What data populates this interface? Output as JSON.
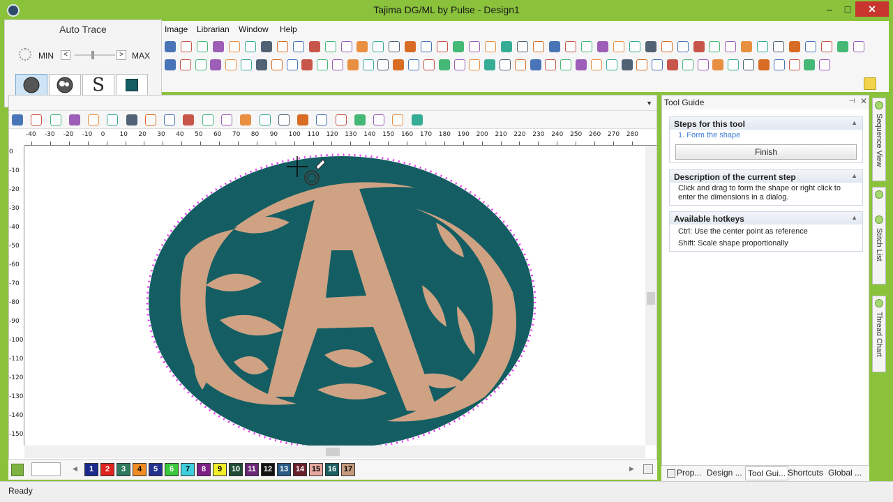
{
  "window": {
    "title": "Tajima DG/ML by Pulse - Design1"
  },
  "window_controls": {
    "minimize": "–",
    "maximize": "□",
    "close": "✕"
  },
  "menu": {
    "items": [
      "Image",
      "Librarian",
      "Window",
      "Help"
    ]
  },
  "auto_trace": {
    "title": "Auto Trace",
    "min_label": "MIN",
    "max_label": "MAX",
    "slider_value": 0.45,
    "left_arrow": "<",
    "right_arrow": ">",
    "modes": [
      "solid-circle-icon",
      "outline-circle-icon",
      "s-stitch-icon",
      "fill-square-icon"
    ],
    "s_glyph": "S"
  },
  "ruler": {
    "h_labels": [
      "-40",
      "-30",
      "-20",
      "-10",
      "0",
      "10",
      "20",
      "30",
      "40",
      "50",
      "60",
      "70",
      "80",
      "90",
      "100",
      "110",
      "120",
      "130",
      "140",
      "150",
      "160",
      "170",
      "180",
      "190",
      "200",
      "210",
      "220",
      "230",
      "240",
      "250",
      "260",
      "270",
      "280"
    ],
    "v_labels": [
      "0",
      "-10",
      "-20",
      "-30",
      "-40",
      "-50",
      "-60",
      "-70",
      "-80",
      "-90",
      "-100",
      "-110",
      "-120",
      "-130",
      "-140",
      "-150"
    ]
  },
  "palette": {
    "left_arrow": "◀",
    "right_arrow": "▶",
    "swatches": [
      {
        "n": "1",
        "color": "#1c2a8e",
        "text": "#ffffff"
      },
      {
        "n": "2",
        "color": "#e0231f",
        "text": "#ffffff"
      },
      {
        "n": "3",
        "color": "#2f7a5f",
        "text": "#ffffff"
      },
      {
        "n": "4",
        "color": "#f08a22",
        "text": "#000000"
      },
      {
        "n": "5",
        "color": "#25318f",
        "text": "#ffffff"
      },
      {
        "n": "6",
        "color": "#3cc83c",
        "text": "#ffffff"
      },
      {
        "n": "7",
        "color": "#3fd0e0",
        "text": "#000000"
      },
      {
        "n": "8",
        "color": "#7e1f86",
        "text": "#ffffff"
      },
      {
        "n": "9",
        "color": "#f3ee2a",
        "text": "#000000"
      },
      {
        "n": "10",
        "color": "#1f4b33",
        "text": "#ffffff"
      },
      {
        "n": "11",
        "color": "#6a2677",
        "text": "#ffffff"
      },
      {
        "n": "12",
        "color": "#111111",
        "text": "#ffffff"
      },
      {
        "n": "13",
        "color": "#2a5b86",
        "text": "#ffffff"
      },
      {
        "n": "14",
        "color": "#6a1f2b",
        "text": "#ffffff"
      },
      {
        "n": "15",
        "color": "#e8a9a0",
        "text": "#000000"
      },
      {
        "n": "16",
        "color": "#1b5e60",
        "text": "#ffffff"
      },
      {
        "n": "17",
        "color": "#c79b7e",
        "text": "#000000"
      }
    ]
  },
  "tool_guide": {
    "title": "Tool Guide",
    "pin": "⊣",
    "close": "✕",
    "steps_header": "Steps for this tool",
    "step_1": "1. Form the shape",
    "finish_label": "Finish",
    "description_header": "Description of the current step",
    "description_text": "Click and drag to form the shape or right click to enter the dimensions in a dialog.",
    "hotkeys_header": "Available hotkeys",
    "hotkey_1": "Ctrl: Use the center point as reference",
    "hotkey_2": "Shift: Scale shape proportionally",
    "collapse_arrow": "▲"
  },
  "side_tabs": [
    "Sequence View",
    "Stitch List",
    "Thread Chart"
  ],
  "bottom_tabs": [
    "Prop...",
    "Design ...",
    "Tool Gui...",
    "Shortcuts",
    "Global ..."
  ],
  "status": {
    "text": "Ready"
  },
  "colors": {
    "teal": "#145e63",
    "tan": "#cfa283",
    "selection": "#e63cf0",
    "chrome_green": "#8ac23c"
  }
}
